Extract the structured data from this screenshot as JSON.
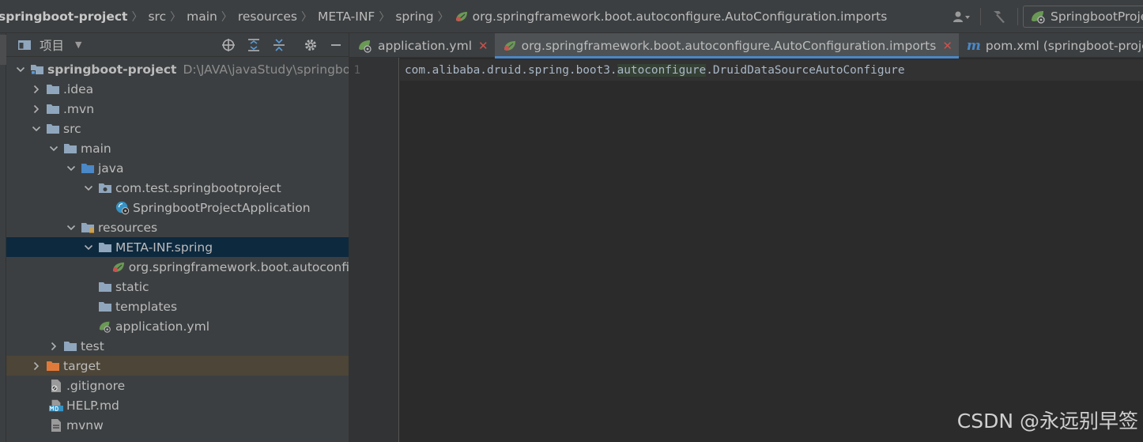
{
  "breadcrumb": {
    "items": [
      "springboot-project",
      "src",
      "main",
      "resources",
      "META-INF",
      "spring",
      "org.springframework.boot.autoconfigure.AutoConfiguration.imports"
    ]
  },
  "toolbar": {
    "run_config": "SpringbootProject"
  },
  "project_panel": {
    "title": "项目",
    "tree": [
      {
        "label": "springboot-project",
        "path": "D:\\JAVA\\javaStudy\\springboot-",
        "depth": 0,
        "state": "open",
        "icon": "project-folder-icon",
        "bold": true
      },
      {
        "label": ".idea",
        "depth": 1,
        "state": "closed",
        "icon": "folder-icon"
      },
      {
        "label": ".mvn",
        "depth": 1,
        "state": "closed",
        "icon": "folder-icon"
      },
      {
        "label": "src",
        "depth": 1,
        "state": "open",
        "icon": "folder-icon"
      },
      {
        "label": "main",
        "depth": 2,
        "state": "open",
        "icon": "folder-icon"
      },
      {
        "label": "java",
        "depth": 3,
        "state": "open",
        "icon": "source-folder-icon"
      },
      {
        "label": "com.test.springbootproject",
        "depth": 4,
        "state": "open",
        "icon": "package-icon"
      },
      {
        "label": "SpringbootProjectApplication",
        "depth": 5,
        "state": "leaf",
        "icon": "spring-boot-class-icon"
      },
      {
        "label": "resources",
        "depth": 3,
        "state": "open",
        "icon": "resources-folder-icon"
      },
      {
        "label": "META-INF.spring",
        "depth": 4,
        "state": "open",
        "icon": "folder-icon",
        "selected": true
      },
      {
        "label": "org.springframework.boot.autoconfi",
        "depth": 5,
        "state": "leaf",
        "icon": "spring-leaf-icon"
      },
      {
        "label": "static",
        "depth": 4,
        "state": "leaf",
        "icon": "folder-icon"
      },
      {
        "label": "templates",
        "depth": 4,
        "state": "leaf",
        "icon": "folder-icon"
      },
      {
        "label": "application.yml",
        "depth": 4,
        "state": "leaf",
        "icon": "spring-config-icon"
      },
      {
        "label": "test",
        "depth": 2,
        "state": "closed",
        "icon": "folder-icon"
      },
      {
        "label": "target",
        "depth": 1,
        "state": "closed",
        "icon": "excluded-folder-icon",
        "excluded": true
      },
      {
        "label": ".gitignore",
        "depth": 2,
        "state": "leaf",
        "icon": "gitignore-icon"
      },
      {
        "label": "HELP.md",
        "depth": 2,
        "state": "leaf",
        "icon": "markdown-icon"
      },
      {
        "label": "mvnw",
        "depth": 2,
        "state": "leaf",
        "icon": "file-icon"
      }
    ]
  },
  "editor": {
    "tabs": [
      {
        "label": "application.yml",
        "icon": "spring-config-icon",
        "closable": true,
        "active": false
      },
      {
        "label": "org.springframework.boot.autoconfigure.AutoConfiguration.imports",
        "icon": "spring-leaf-icon",
        "closable": true,
        "active": true
      },
      {
        "label": "pom.xml (springboot-project)",
        "icon": "maven-icon",
        "closable": false,
        "active": false
      }
    ],
    "line_number": "1",
    "code_before": "com.alibaba.druid.spring.boot3.",
    "code_highlight": "autoconfigure",
    "code_after": ".DruidDataSourceAutoConfigure"
  },
  "watermark": "CSDN @永远别早签",
  "colors": {
    "background": "#2b2b2b",
    "panel": "#3c3f41",
    "selection": "#0d293e",
    "excluded": "#4c4538",
    "accent": "#4a88c7"
  }
}
